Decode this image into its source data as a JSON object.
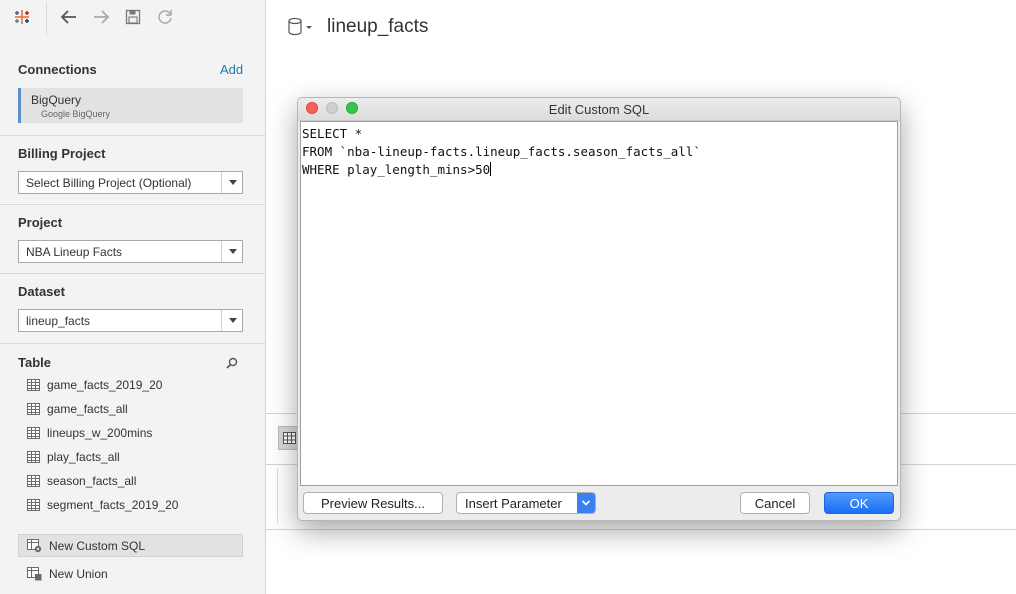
{
  "main": {
    "datasource_title": "lineup_facts"
  },
  "sidebar": {
    "connections": {
      "title": "Connections",
      "add_label": "Add",
      "name": "BigQuery",
      "subtitle": "Google BigQuery"
    },
    "billing": {
      "title": "Billing Project",
      "value": "Select Billing Project (Optional)"
    },
    "project": {
      "title": "Project",
      "value": "NBA Lineup Facts"
    },
    "dataset": {
      "title": "Dataset",
      "value": "lineup_facts"
    },
    "table": {
      "title": "Table",
      "items": [
        "game_facts_2019_20",
        "game_facts_all",
        "lineups_w_200mins",
        "play_facts_all",
        "season_facts_all",
        "segment_facts_2019_20"
      ],
      "custom_sql_label": "New Custom SQL",
      "union_label": "New Union"
    }
  },
  "dialog": {
    "title": "Edit Custom SQL",
    "sql_lines": [
      "SELECT *",
      "FROM `nba-lineup-facts.lineup_facts.season_facts_all`",
      "WHERE play_length_mins>50"
    ],
    "buttons": {
      "preview": "Preview Results...",
      "insert_parameter": "Insert Parameter",
      "cancel": "Cancel",
      "ok": "OK"
    }
  },
  "colors": {
    "accent_blue": "#1a6ff2",
    "link_blue": "#1f77b4",
    "close_red": "#fc605c",
    "max_green": "#34c84a"
  }
}
